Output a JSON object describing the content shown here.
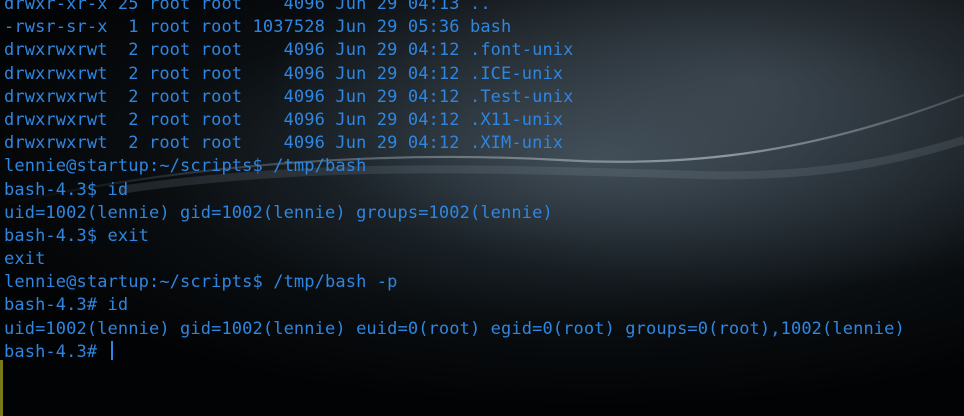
{
  "terminal": {
    "lines": [
      "drwxr-xr-x 25 root root    4096 Jun 29 04:13 ..",
      "-rwsr-sr-x  1 root root 1037528 Jun 29 05:36 bash",
      "drwxrwxrwt  2 root root    4096 Jun 29 04:12 .font-unix",
      "drwxrwxrwt  2 root root    4096 Jun 29 04:12 .ICE-unix",
      "drwxrwxrwt  2 root root    4096 Jun 29 04:12 .Test-unix",
      "drwxrwxrwt  2 root root    4096 Jun 29 04:12 .X11-unix",
      "drwxrwxrwt  2 root root    4096 Jun 29 04:12 .XIM-unix",
      "lennie@startup:~/scripts$ /tmp/bash",
      "bash-4.3$ id",
      "uid=1002(lennie) gid=1002(lennie) groups=1002(lennie)",
      "bash-4.3$ exit",
      "exit",
      "lennie@startup:~/scripts$ /tmp/bash -p",
      "bash-4.3# id",
      "uid=1002(lennie) gid=1002(lennie) euid=0(root) egid=0(root) groups=0(root),1002(lennie)"
    ],
    "prompt": "bash-4.3# ",
    "text_color": "#2f86e0"
  }
}
